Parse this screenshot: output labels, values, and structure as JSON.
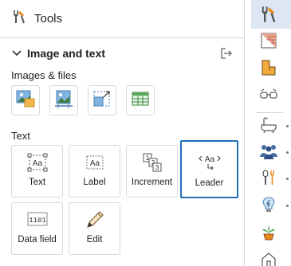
{
  "header": {
    "title": "Tools",
    "icon": "tools-icon"
  },
  "section": {
    "label": "Image and text",
    "collapse_icon": "chevron-down-icon",
    "export_icon": "export-icon"
  },
  "images_group": {
    "label": "Images & files",
    "items": [
      {
        "name": "image-icon"
      },
      {
        "name": "image-frame-icon"
      },
      {
        "name": "resize-image-icon"
      },
      {
        "name": "table-icon"
      }
    ]
  },
  "text_group": {
    "label": "Text",
    "items": [
      {
        "label": "Text",
        "icon": "text-box-icon"
      },
      {
        "label": "Label",
        "icon": "label-icon"
      },
      {
        "label": "Increment",
        "icon": "increment-icon"
      },
      {
        "label": "Leader",
        "icon": "leader-icon",
        "selected": true
      },
      {
        "label": "Data field",
        "icon": "data-field-icon",
        "sample": "1101"
      },
      {
        "label": "Edit",
        "icon": "pencil-icon"
      }
    ],
    "glyph": "Aa"
  },
  "rail": {
    "items": [
      "tools-icon",
      "brick-wall-icon",
      "floor-plan-icon",
      "glasses-icon",
      "bathtub-icon",
      "people-icon",
      "kitchen-utensils-icon",
      "lightbulb-icon",
      "plant-icon",
      "house-icon"
    ],
    "selected": "tools-icon"
  },
  "colors": {
    "accent": "#1f6fb5",
    "icon_orange": "#e8891c",
    "selected_bg": "#dde6f3",
    "border": "#d9d9d9"
  }
}
